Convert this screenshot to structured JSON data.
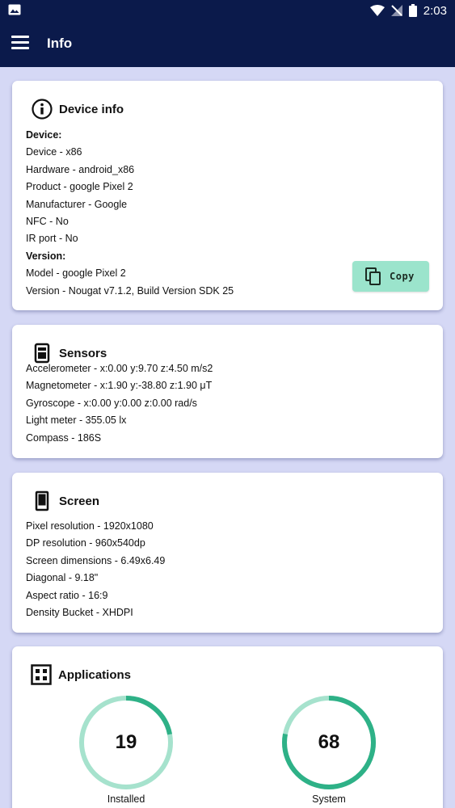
{
  "status_bar": {
    "time": "2:03"
  },
  "app_bar": {
    "title": "Info"
  },
  "device_card": {
    "title": "Device info",
    "rows": [
      {
        "text": "Device:",
        "bold": true
      },
      {
        "text": "Device - x86"
      },
      {
        "text": "Hardware - android_x86"
      },
      {
        "text": "Product - google Pixel 2"
      },
      {
        "text": "Manufacturer - Google"
      },
      {
        "text": "NFC - No"
      },
      {
        "text": "IR port - No"
      },
      {
        "text": "Version:",
        "bold": true
      },
      {
        "text": "Model - google Pixel 2"
      },
      {
        "text": "Version - Nougat v7.1.2, Build Version SDK 25"
      }
    ],
    "copy_label": "Copy"
  },
  "sensors_card": {
    "title": "Sensors",
    "rows": [
      {
        "text": "Accelerometer - x:0.00 y:9.70 z:4.50 m/s2"
      },
      {
        "text": "Magnetometer - x:1.90 y:-38.80 z:1.90 μT"
      },
      {
        "text": "Gyroscope - x:0.00 y:0.00 z:0.00 rad/s"
      },
      {
        "text": "Light meter - 355.05 lx"
      },
      {
        "text": "Compass - 186S"
      }
    ]
  },
  "screen_card": {
    "title": "Screen",
    "rows": [
      {
        "text": "Pixel resolution - 1920x1080"
      },
      {
        "text": "DP resolution - 960x540dp"
      },
      {
        "text": "Screen dimensions - 6.49x6.49"
      },
      {
        "text": "Diagonal - 9.18\""
      },
      {
        "text": "Aspect ratio - 16:9"
      },
      {
        "text": "Density Bucket - XHDPI"
      }
    ]
  },
  "apps_card": {
    "title": "Applications",
    "installed": {
      "value": "19",
      "label": "Installed",
      "fraction": 0.22
    },
    "system": {
      "value": "68",
      "label": "System",
      "fraction": 0.78
    }
  },
  "colors": {
    "app_bar": "#0b1a4b",
    "background": "#d5d8f5",
    "accent": "#2eb187",
    "accent_light": "#a6e2cd",
    "button": "#9be4cc"
  }
}
